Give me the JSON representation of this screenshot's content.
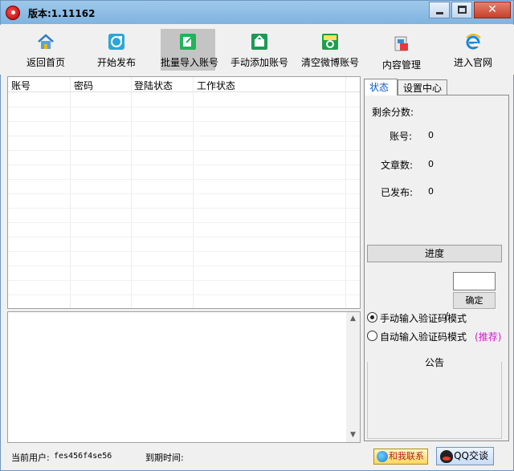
{
  "window": {
    "title": "版本:1.11162",
    "close_glyph": "✕"
  },
  "toolbar": {
    "items": [
      {
        "label": "返回首页",
        "icon": "home-icon"
      },
      {
        "label": "开始发布",
        "icon": "refresh-icon"
      },
      {
        "label": "批量导入账号",
        "icon": "import-icon"
      },
      {
        "label": "手动添加账号",
        "icon": "add-account-icon"
      },
      {
        "label": "清空微博账号",
        "icon": "recycle-icon"
      },
      {
        "label": "内容管理",
        "icon": "content-icon"
      },
      {
        "label": "进入官网",
        "icon": "ie-icon"
      }
    ],
    "active_index": 2
  },
  "table": {
    "columns": [
      "账号",
      "密码",
      "登陆状态",
      "工作状态"
    ]
  },
  "scrollbar": {
    "up_glyph": "▲",
    "down_glyph": "▼"
  },
  "panel": {
    "tabs": [
      "状态",
      "设置中心"
    ],
    "remaining_points_label": "剩余分数:",
    "account_label": "账号:",
    "account_value": "0",
    "articles_label": "文章数:",
    "articles_value": "0",
    "published_label": "已发布:",
    "published_value": "0",
    "progress_label": "进度",
    "ok_label": "确定",
    "slash": "/",
    "manual_mode_label": "手动输入验证码模式",
    "auto_mode_label": "自动输入验证码模式",
    "recommend_label": "(推荐)",
    "notice_label": "公告"
  },
  "statusbar": {
    "user_label": "当前用户:",
    "user_value": "fes456f4se56",
    "expire_label": "到期时间:",
    "contact_label": "和我联系",
    "qq_label": "QQ交谈"
  }
}
